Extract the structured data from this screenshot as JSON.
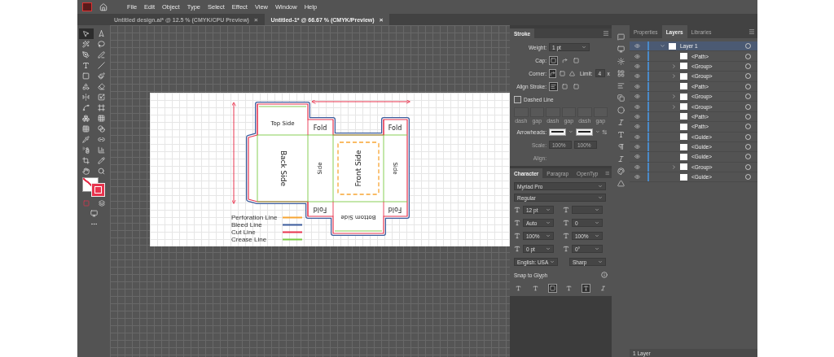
{
  "menu": [
    "File",
    "Edit",
    "Object",
    "Type",
    "Select",
    "Effect",
    "View",
    "Window",
    "Help"
  ],
  "documents": [
    {
      "title": "Untitled design.ai* @ 12.5 % (CMYK/CPU Preview)",
      "close": "×",
      "selected": false
    },
    {
      "title": "Untitled-1* @ 66.67 % (CMYK/Preview)",
      "close": "×",
      "selected": true
    }
  ],
  "artboard": {
    "labels": [
      "Top Side",
      "Fold",
      "Fold",
      "Back Side",
      "Side",
      "Front Side",
      "Side",
      "Fold",
      "Bottom Side",
      "Fold"
    ],
    "legend": [
      {
        "label": "Perforation Line",
        "color": "#f7a533"
      },
      {
        "label": "Bleed Line",
        "color": "#3b5b9c"
      },
      {
        "label": "Cut Line",
        "color": "#e8344e"
      },
      {
        "label": "Crease Line",
        "color": "#7ac943"
      }
    ]
  },
  "stroke_panel": {
    "title": "Stroke",
    "weight_label": "Weight:",
    "weight": "1 pt",
    "cap_label": "Cap:",
    "cap": [
      {
        "selected": true
      },
      {
        "selected": false
      },
      {
        "selected": false
      }
    ],
    "corner_label": "Corner:",
    "corner": [
      {
        "selected": true
      },
      {
        "selected": false
      },
      {
        "selected": false
      }
    ],
    "limit_label": "Limit:",
    "limit": "4",
    "limit_unit": "x",
    "align_label": "Align Stroke:",
    "align": [
      {
        "selected": true
      },
      {
        "selected": false
      },
      {
        "selected": false
      }
    ],
    "dashed": {
      "label": "Dashed Line",
      "checked": false
    },
    "dash_labels": [
      "dash",
      "gap",
      "dash",
      "gap",
      "dash",
      "gap"
    ],
    "arrowheads_label": "Arrowheads:",
    "scale_label": "Scale:",
    "scales": [
      "100%",
      "100%"
    ],
    "arrow_align_label": "Align:"
  },
  "character_panel": {
    "tabs": [
      {
        "label": "Character",
        "selected": true
      },
      {
        "label": "Paragrap",
        "selected": false
      },
      {
        "label": "OpenTyp",
        "selected": false
      }
    ],
    "font": "Myriad Pro",
    "style": "Regular",
    "fields": [
      "12 pt",
      "Auto",
      "0",
      "100%",
      "100%",
      "0 pt",
      "0°"
    ],
    "language": "English: USA",
    "antialias": "Sharp",
    "snap_label": "Snap to Glyph",
    "snap_options": [
      {
        "selected": false
      },
      {
        "selected": false
      },
      {
        "selected": true
      },
      {
        "selected": false
      },
      {
        "selected": true
      },
      {
        "selected": false
      }
    ]
  },
  "layers_panel": {
    "tabs": [
      {
        "label": "Properties",
        "selected": false
      },
      {
        "label": "Layers",
        "selected": true
      },
      {
        "label": "Libraries",
        "selected": false
      }
    ],
    "layers": [
      {
        "name": "Layer 1",
        "expanded": true,
        "selected": true,
        "children": [
          {
            "name": "<Path>"
          },
          {
            "name": "<Group>",
            "expanded": false
          },
          {
            "name": "<Group>",
            "expanded": false
          },
          {
            "name": "<Path>"
          },
          {
            "name": "<Group>",
            "expanded": false
          },
          {
            "name": "<Group>",
            "expanded": false
          },
          {
            "name": "<Path>"
          },
          {
            "name": "<Path>"
          },
          {
            "name": "<Guide>"
          },
          {
            "name": "<Guide>"
          },
          {
            "name": "<Guide>"
          },
          {
            "name": "<Group>",
            "expanded": false
          },
          {
            "name": "<Guide>"
          }
        ]
      }
    ],
    "footer": "1 Layer"
  }
}
